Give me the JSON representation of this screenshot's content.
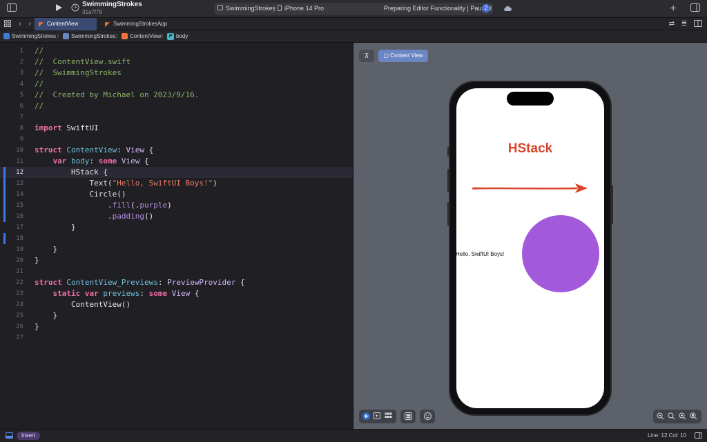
{
  "toolbar": {
    "project_name": "SwimmingStrokes",
    "commit": "31a7f79",
    "scheme": "SwimmingStrokes",
    "destination": "iPhone 14 Pro",
    "status": "Preparing Editor Functionality | Paused",
    "status_count": "2",
    "add_icon": "+"
  },
  "tabs": [
    {
      "label": "ContentView",
      "active": true
    },
    {
      "label": "SwimmingStrokesApp",
      "active": false
    }
  ],
  "breadcrumb": [
    "SwimmingStrokes",
    "SwimmingStrokes",
    "ContentView",
    "body"
  ],
  "code": [
    {
      "n": "1",
      "parts": [
        [
          "//",
          "c-cmt"
        ]
      ]
    },
    {
      "n": "2",
      "parts": [
        [
          "//  ContentView.swift",
          "c-cmt"
        ]
      ]
    },
    {
      "n": "3",
      "parts": [
        [
          "//  SwimmingStrokes",
          "c-cmt"
        ]
      ]
    },
    {
      "n": "4",
      "parts": [
        [
          "//",
          "c-cmt"
        ]
      ]
    },
    {
      "n": "5",
      "parts": [
        [
          "//  Created by Michael on 2023/9/16.",
          "c-cmt"
        ]
      ]
    },
    {
      "n": "6",
      "parts": [
        [
          "//",
          "c-cmt"
        ]
      ]
    },
    {
      "n": "7",
      "parts": []
    },
    {
      "n": "8",
      "parts": [
        [
          "import",
          "c-kw"
        ],
        [
          " SwiftUI",
          "c-pl"
        ]
      ]
    },
    {
      "n": "9",
      "parts": []
    },
    {
      "n": "10",
      "parts": [
        [
          "struct",
          "c-kw"
        ],
        [
          " ",
          "c-pl"
        ],
        [
          "ContentView",
          "c-id"
        ],
        [
          ": ",
          "c-pl"
        ],
        [
          "View",
          "c-type"
        ],
        [
          " {",
          "c-pl"
        ]
      ]
    },
    {
      "n": "11",
      "parts": [
        [
          "    ",
          "c-pl"
        ],
        [
          "var",
          "c-kw"
        ],
        [
          " ",
          "c-pl"
        ],
        [
          "body",
          "c-id"
        ],
        [
          ": ",
          "c-pl"
        ],
        [
          "some",
          "c-kw"
        ],
        [
          " ",
          "c-pl"
        ],
        [
          "View",
          "c-type"
        ],
        [
          " {",
          "c-pl"
        ]
      ]
    },
    {
      "n": "12",
      "parts": [
        [
          "        HStack {",
          "c-pl"
        ]
      ],
      "current": true
    },
    {
      "n": "13",
      "parts": [
        [
          "            Text(",
          "c-pl"
        ],
        [
          "\"Hello, SwiftUI Boys!\"",
          "c-str"
        ],
        [
          ")",
          "c-pl"
        ]
      ]
    },
    {
      "n": "14",
      "parts": [
        [
          "            Circle()",
          "c-pl"
        ]
      ]
    },
    {
      "n": "15",
      "parts": [
        [
          "                .",
          "c-pl"
        ],
        [
          "fill",
          "c-fn"
        ],
        [
          "(.",
          "c-pl"
        ],
        [
          "purple",
          "c-fn"
        ],
        [
          ")",
          "c-pl"
        ]
      ]
    },
    {
      "n": "16",
      "parts": [
        [
          "                .",
          "c-pl"
        ],
        [
          "padding",
          "c-fn"
        ],
        [
          "()",
          "c-pl"
        ]
      ]
    },
    {
      "n": "17",
      "parts": [
        [
          "        }",
          "c-pl"
        ]
      ]
    },
    {
      "n": "18",
      "parts": []
    },
    {
      "n": "19",
      "parts": [
        [
          "    }",
          "c-pl"
        ]
      ]
    },
    {
      "n": "20",
      "parts": [
        [
          "}",
          "c-pl"
        ]
      ]
    },
    {
      "n": "21",
      "parts": []
    },
    {
      "n": "22",
      "parts": [
        [
          "struct",
          "c-kw"
        ],
        [
          " ",
          "c-pl"
        ],
        [
          "ContentView_Previews",
          "c-id"
        ],
        [
          ": ",
          "c-pl"
        ],
        [
          "PreviewProvider",
          "c-type"
        ],
        [
          " {",
          "c-pl"
        ]
      ]
    },
    {
      "n": "23",
      "parts": [
        [
          "    ",
          "c-pl"
        ],
        [
          "static",
          "c-kw"
        ],
        [
          " ",
          "c-pl"
        ],
        [
          "var",
          "c-kw"
        ],
        [
          " ",
          "c-pl"
        ],
        [
          "previews",
          "c-id"
        ],
        [
          ": ",
          "c-pl"
        ],
        [
          "some",
          "c-kw"
        ],
        [
          " ",
          "c-pl"
        ],
        [
          "View",
          "c-type"
        ],
        [
          " {",
          "c-pl"
        ]
      ]
    },
    {
      "n": "24",
      "parts": [
        [
          "        ContentView()",
          "c-pl"
        ]
      ]
    },
    {
      "n": "25",
      "parts": [
        [
          "    }",
          "c-pl"
        ]
      ]
    },
    {
      "n": "26",
      "parts": [
        [
          "}",
          "c-pl"
        ]
      ]
    },
    {
      "n": "27",
      "parts": []
    }
  ],
  "canvas": {
    "preview_label": "Content View",
    "annotation_title": "HStack",
    "preview_text": "Hello, SwiftUI Boys!",
    "circle_color": "#a25adb",
    "annotation_color": "#d9442a"
  },
  "statusbar": {
    "mode": "Insert",
    "position": "Line: 12  Col: 10"
  }
}
